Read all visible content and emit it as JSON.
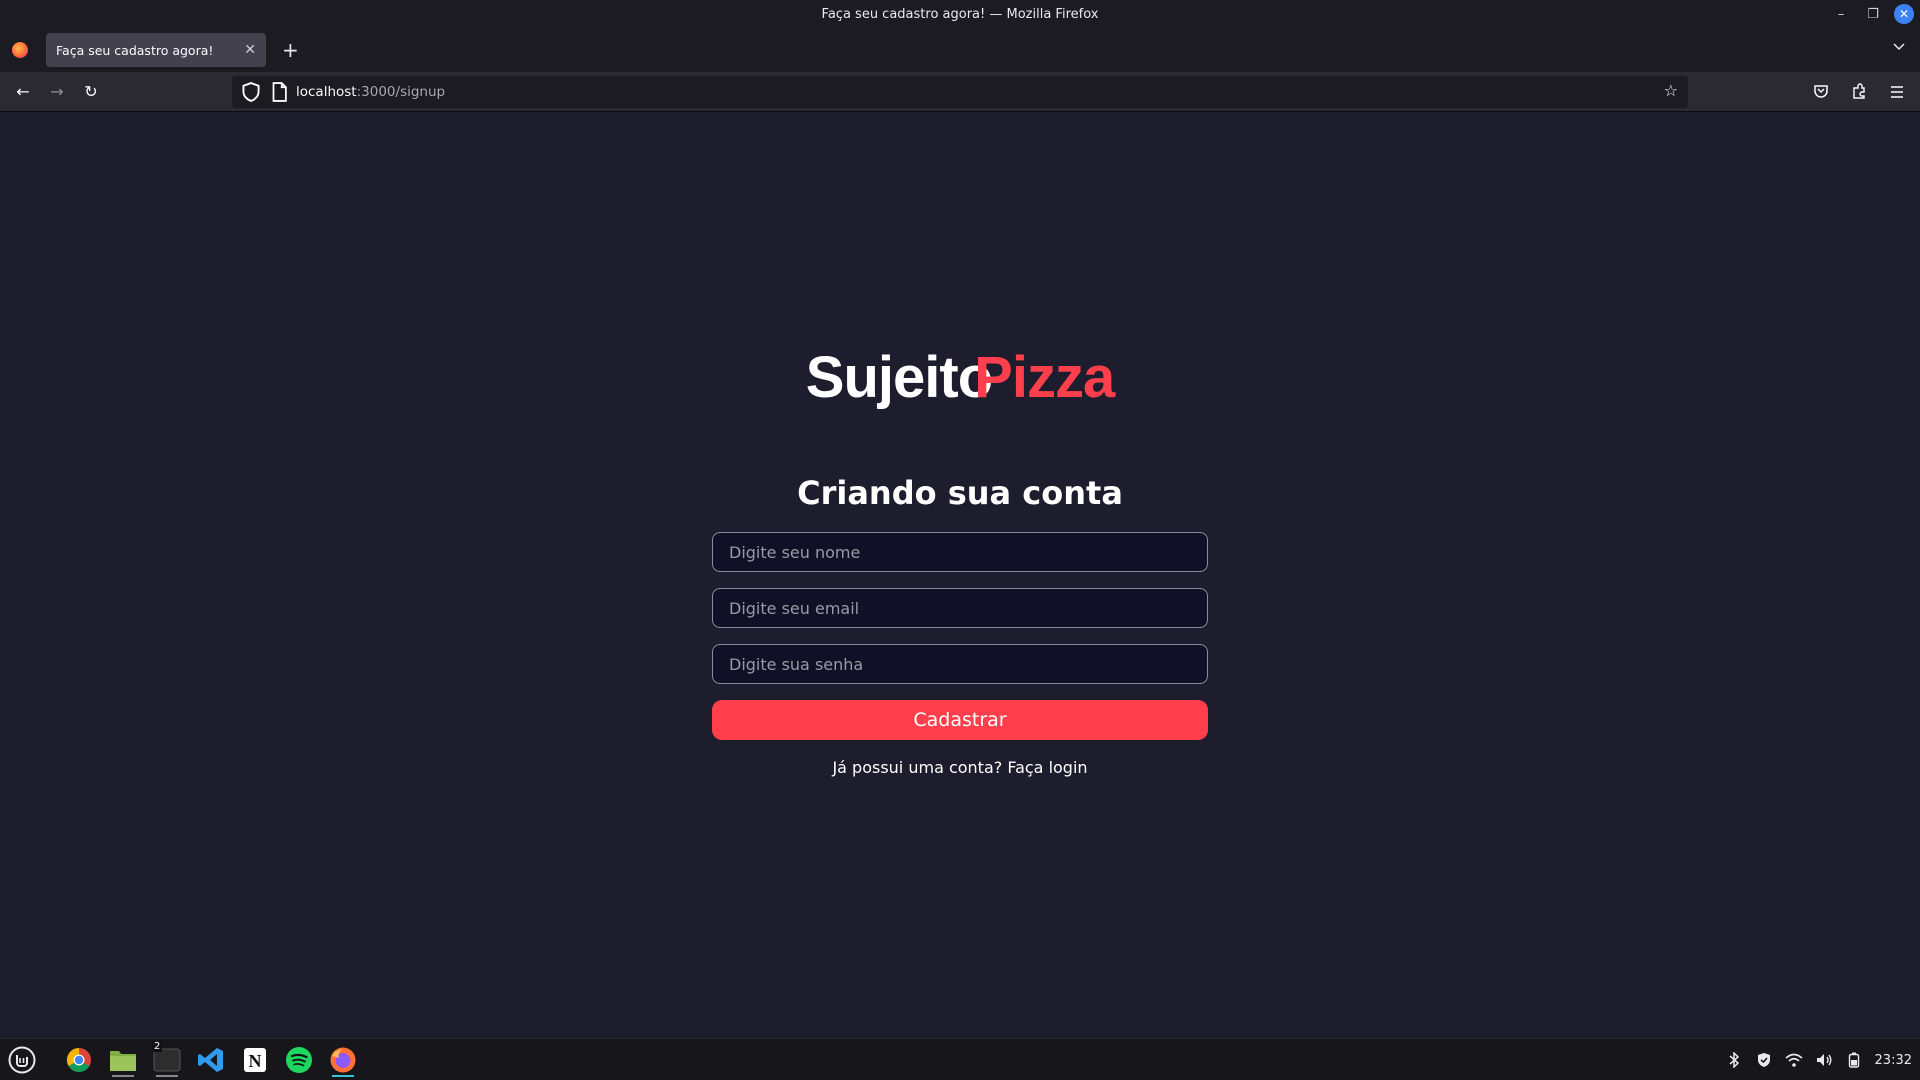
{
  "window": {
    "title": "Faça seu cadastro agora! — Mozilla Firefox"
  },
  "tab": {
    "title": "Faça seu cadastro agora!"
  },
  "url": {
    "host": "localhost",
    "path": ":3000/signup"
  },
  "page": {
    "logo_part1": "Sujeito",
    "logo_part2": "Pizza",
    "heading": "Criando sua conta",
    "name_placeholder": "Digite seu nome",
    "email_placeholder": "Digite seu email",
    "password_placeholder": "Digite sua senha",
    "submit_label": "Cadastrar",
    "login_text": "Já possui uma conta? Faça login"
  },
  "taskbar": {
    "terminal_badge": "2",
    "clock": "23:32"
  },
  "colors": {
    "accent": "#ff3f4b",
    "background": "#1d1d2e",
    "input_bg": "#101026"
  }
}
